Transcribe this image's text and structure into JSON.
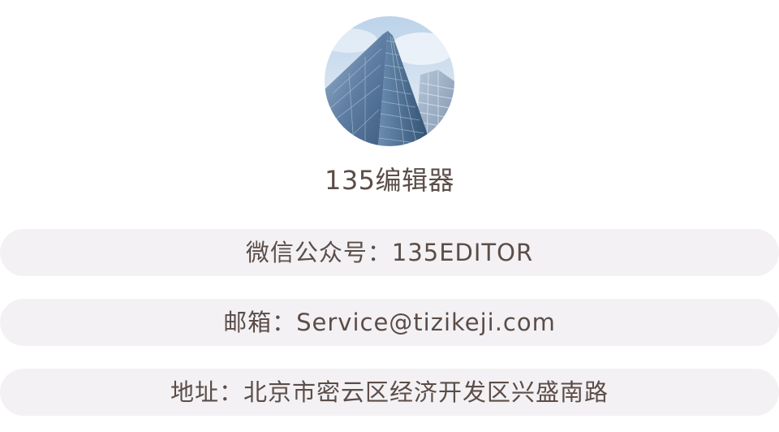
{
  "profile": {
    "avatar_icon": "skyscraper-photo",
    "name": "135编辑器"
  },
  "info": {
    "wechat": "微信公众号：135EDITOR",
    "email": "邮箱：Service@tizikeji.com",
    "address": "地址：北京市密云区经济开发区兴盛南路"
  },
  "colors": {
    "text": "#5b4d48",
    "pill_background": "#f3f1f4",
    "page_background": "#ffffff"
  }
}
